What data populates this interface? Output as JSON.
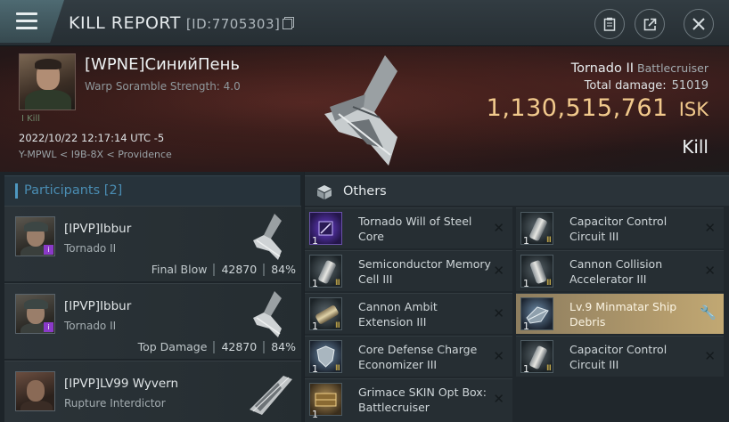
{
  "header": {
    "title": "KILL REPORT",
    "report_id": "[ID:7705303]",
    "icons": [
      "menu-icon",
      "copy-icon",
      "clipboard-icon",
      "share-icon",
      "close-icon"
    ]
  },
  "victim": {
    "pilot_name": "[WPNE]СинийПень",
    "warp_scramble": "Warp Soramble Strength: 4.0",
    "corp_tag": "I Kill",
    "datetime": "2022/10/22 12:17:14 UTC -5",
    "location": "Y-MPWL < I9B-8X < Providence",
    "ship": "Tornado II",
    "ship_class": "Battlecruiser",
    "total_damage_label": "Total damage:",
    "total_damage": "51019",
    "isk_value": "1,130,515,761",
    "isk_currency": "ISK",
    "result": "Kill"
  },
  "participants": {
    "label": "Participants",
    "count": "[2]",
    "list": [
      {
        "name": "[IPVP]Ibbur",
        "ship": "Tornado II",
        "role": "Final Blow",
        "damage": "42870",
        "percent": "84%"
      },
      {
        "name": "[IPVP]Ibbur",
        "ship": "Tornado II",
        "role": "Top Damage",
        "damage": "42870",
        "percent": "84%"
      },
      {
        "name": "[IPVP]LV99 Wyvern",
        "ship": "Rupture Interdictor"
      }
    ]
  },
  "others": {
    "label": "Others",
    "items": [
      {
        "name": "Tornado Will of Steel Core",
        "qty": "1",
        "icon": "purple-core-icon"
      },
      {
        "name": "Capacitor Control Circuit III",
        "qty": "1",
        "meta": "III",
        "icon": "cylinder-icon"
      },
      {
        "name": "Semiconductor Memory Cell III",
        "qty": "1",
        "meta": "III",
        "icon": "cylinder-icon"
      },
      {
        "name": "Cannon Collision Accelerator III",
        "qty": "1",
        "meta": "III",
        "icon": "cylinder-icon"
      },
      {
        "name": "Cannon Ambit Extension III",
        "qty": "1",
        "meta": "III",
        "icon": "cannon-icon"
      },
      {
        "name": "Lv.9 Minmatar Ship Debris",
        "qty": "1",
        "icon": "debris-icon",
        "highlighted": true
      },
      {
        "name": "Core Defense Charge Economizer III",
        "qty": "1",
        "meta": "III",
        "icon": "shield-icon"
      },
      {
        "name": "Capacitor Control Circuit III",
        "qty": "1",
        "meta": "III",
        "icon": "cylinder-icon"
      },
      {
        "name": "Grimace SKIN Opt Box: Battlecruiser",
        "qty": "1",
        "icon": "crate-icon"
      }
    ]
  },
  "colors": {
    "isk_gold": "#f1c98c",
    "participants_blue": "#4a8db3",
    "highlight_gold": "#b39b6c",
    "badge_purple": "#8a3ac8"
  }
}
